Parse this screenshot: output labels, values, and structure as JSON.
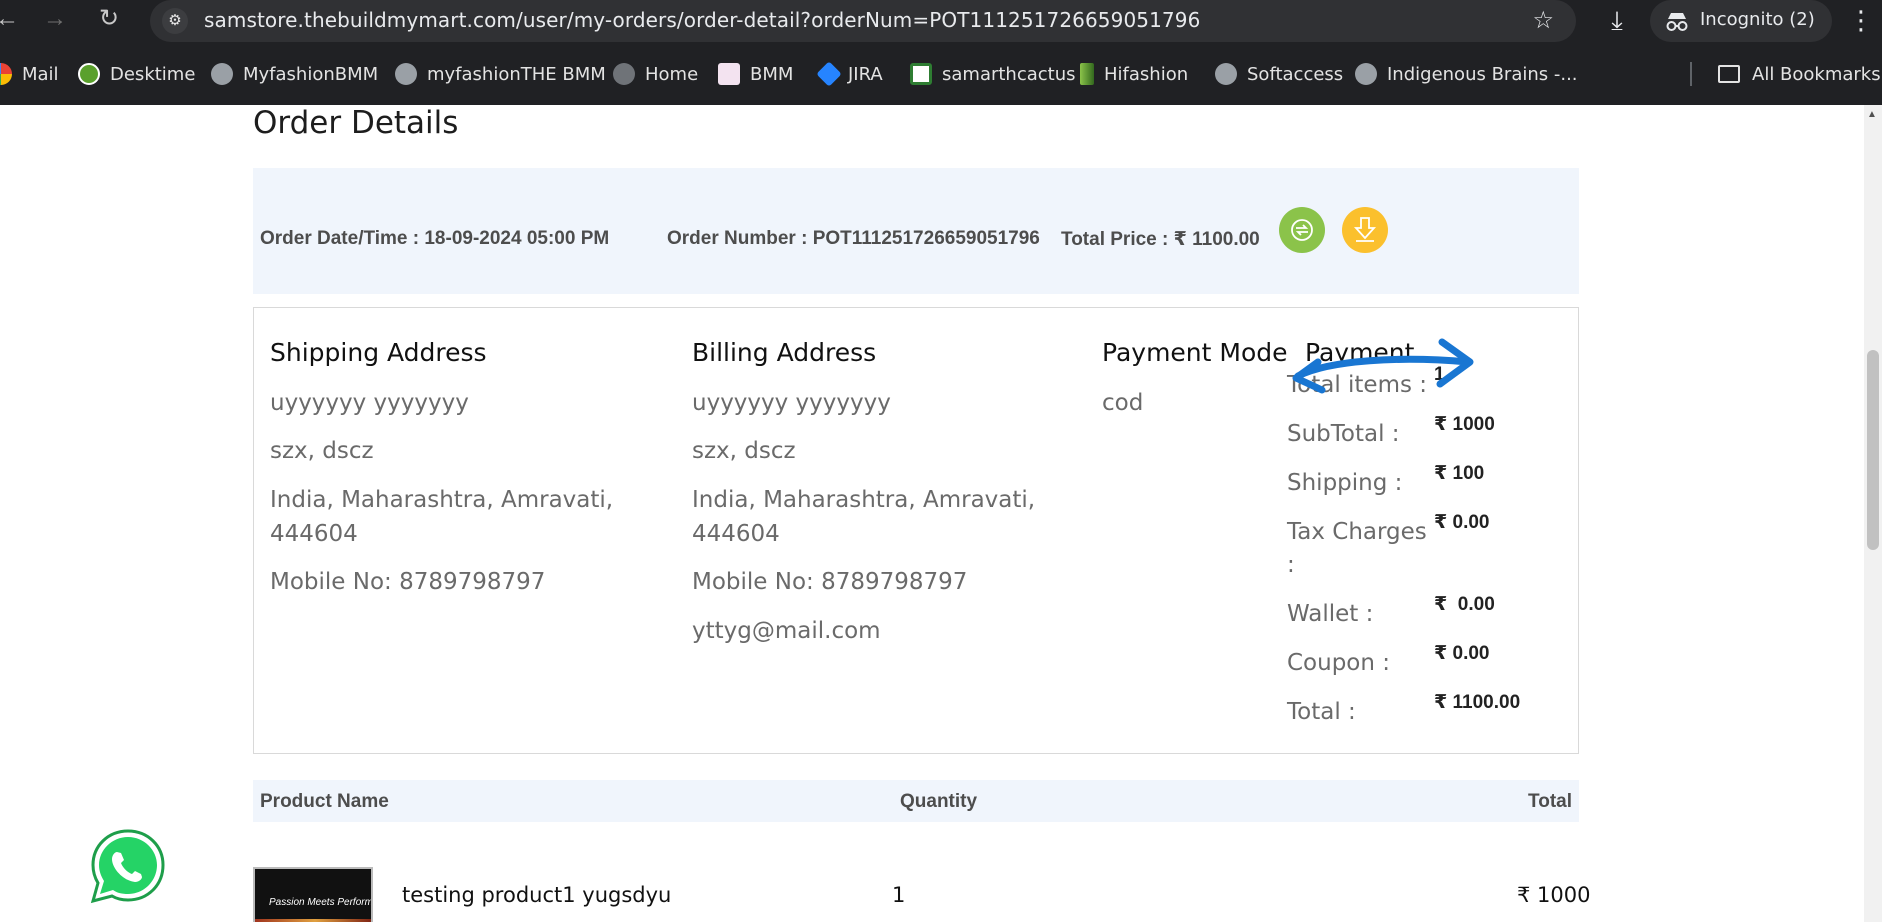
{
  "browser": {
    "url": "samstore.thebuildmymart.com/user/my-orders/order-detail?orderNum=POT111251726659051796",
    "incognito_label": "Incognito (2)",
    "bookmarks": [
      {
        "label": "Mail",
        "icon": "google-icon"
      },
      {
        "label": "Desktime",
        "icon": "desktime-icon"
      },
      {
        "label": "MyfashionBMM",
        "icon": "globe-icon"
      },
      {
        "label": "myfashionTHE BMM",
        "icon": "globe-icon"
      },
      {
        "label": "Home",
        "icon": "globe-icon"
      },
      {
        "label": "BMM",
        "icon": "bmm-icon"
      },
      {
        "label": "JIRA",
        "icon": "jira-icon"
      },
      {
        "label": "samarthcactus",
        "icon": "cactus-icon"
      },
      {
        "label": "Hifashion",
        "icon": "hifashion-icon"
      },
      {
        "label": "Softaccess",
        "icon": "globe-icon"
      },
      {
        "label": "Indigenous Brains -...",
        "icon": "globe-icon"
      }
    ],
    "all_bookmarks_label": "All Bookmarks"
  },
  "page": {
    "title": "Order Details",
    "summary": {
      "order_date": "Order Date/Time : 18-09-2024 05:00 PM",
      "order_number": "Order Number : POT111251726659051796",
      "total_price": "Total Price : ₹ 1100.00"
    },
    "shipping": {
      "heading": "Shipping Address",
      "name": "uyyyyyy yyyyyyy",
      "line1": "szx, dscz",
      "line2a": "India, Maharashtra, Amravati,",
      "line2b": "444604",
      "mobile": "Mobile No: 8789798797"
    },
    "billing": {
      "heading": "Billing Address",
      "name": "uyyyyyy yyyyyyy",
      "line1": "szx, dscz",
      "line2a": "India, Maharashtra, Amravati,",
      "line2b": "444604",
      "mobile": "Mobile No: 8789798797",
      "email": "yttyg@mail.com"
    },
    "payment_mode": {
      "heading": "Payment Mode",
      "value": "cod"
    },
    "payment": {
      "heading": "Payment",
      "rows": [
        {
          "label": "Total items :",
          "value": "1"
        },
        {
          "label": "SubTotal :",
          "value": "₹ 1000"
        },
        {
          "label": "Shipping :",
          "value": "₹ 100"
        },
        {
          "label": "Tax Charges",
          "label2": ":",
          "value": "₹ 0.00"
        },
        {
          "label": "Wallet :",
          "value": "₹  0.00"
        },
        {
          "label": "Coupon :",
          "value": "₹ 0.00"
        },
        {
          "label": "Total :",
          "value": "₹ 1100.00"
        }
      ]
    },
    "table": {
      "headers": {
        "product": "Product Name",
        "quantity": "Quantity",
        "total": "Total"
      },
      "rows": [
        {
          "name": "testing product1 yugsdyu",
          "quantity": "1",
          "total": "₹ 1000",
          "image_caption": "Passion Meets Performance"
        }
      ]
    },
    "colors": {
      "refresh_button": "#8bc34a",
      "download_button": "#fbc02d",
      "summary_bg": "#f0f5fc",
      "annotation_arrow": "#1976d2",
      "whatsapp_green": "#25d366"
    }
  }
}
